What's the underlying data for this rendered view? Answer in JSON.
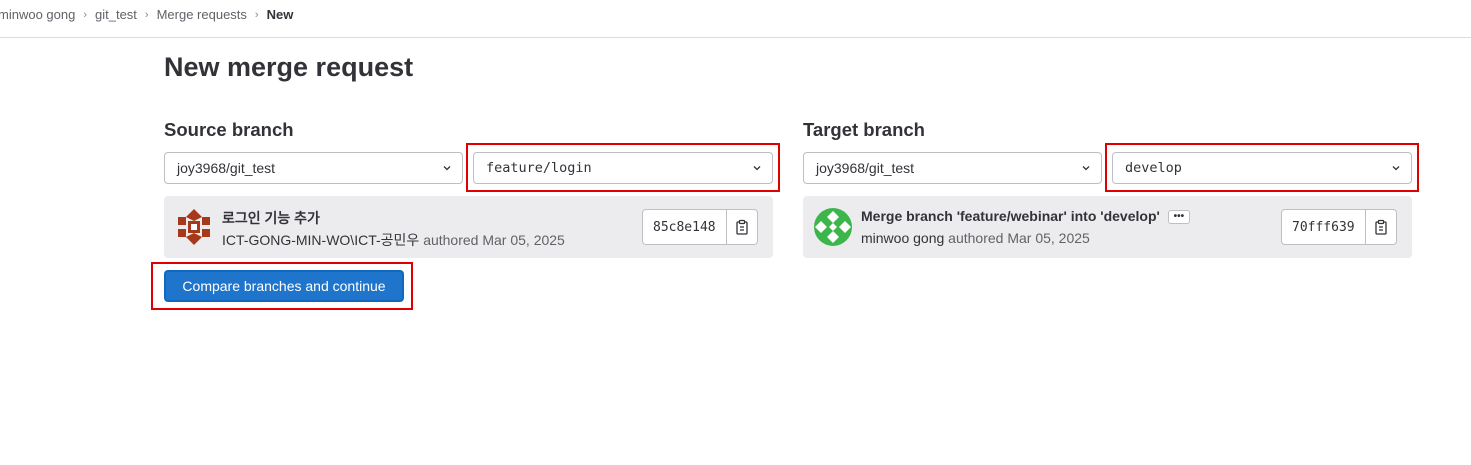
{
  "breadcrumb": {
    "items": [
      "minwoo gong",
      "git_test",
      "Merge requests",
      "New"
    ]
  },
  "page": {
    "title": "New merge request"
  },
  "source": {
    "heading": "Source branch",
    "project": "joy3968/git_test",
    "branch": "feature/login",
    "commit": {
      "title": "로그인 기능 추가",
      "author": "ICT-GONG-MIN-WO\\ICT-공민우",
      "authored": "authored Mar 05, 2025",
      "sha": "85c8e148"
    }
  },
  "target": {
    "heading": "Target branch",
    "project": "joy3968/git_test",
    "branch": "develop",
    "commit": {
      "title": "Merge branch 'feature/webinar' into 'develop'",
      "ellipsis": "•••",
      "author": "minwoo gong",
      "authored": "authored Mar 05, 2025",
      "sha": "70fff639"
    }
  },
  "actions": {
    "compare_label": "Compare branches and continue"
  },
  "icons": {
    "chevron": "chevron-down-icon",
    "copy": "clipboard-icon",
    "avatar_source": "identicon-orange",
    "avatar_target": "identicon-green"
  },
  "colors": {
    "primary": "#1f75cb",
    "highlight": "#e00000",
    "avatar_source": "#a8381a",
    "avatar_target": "#3cb54a"
  }
}
